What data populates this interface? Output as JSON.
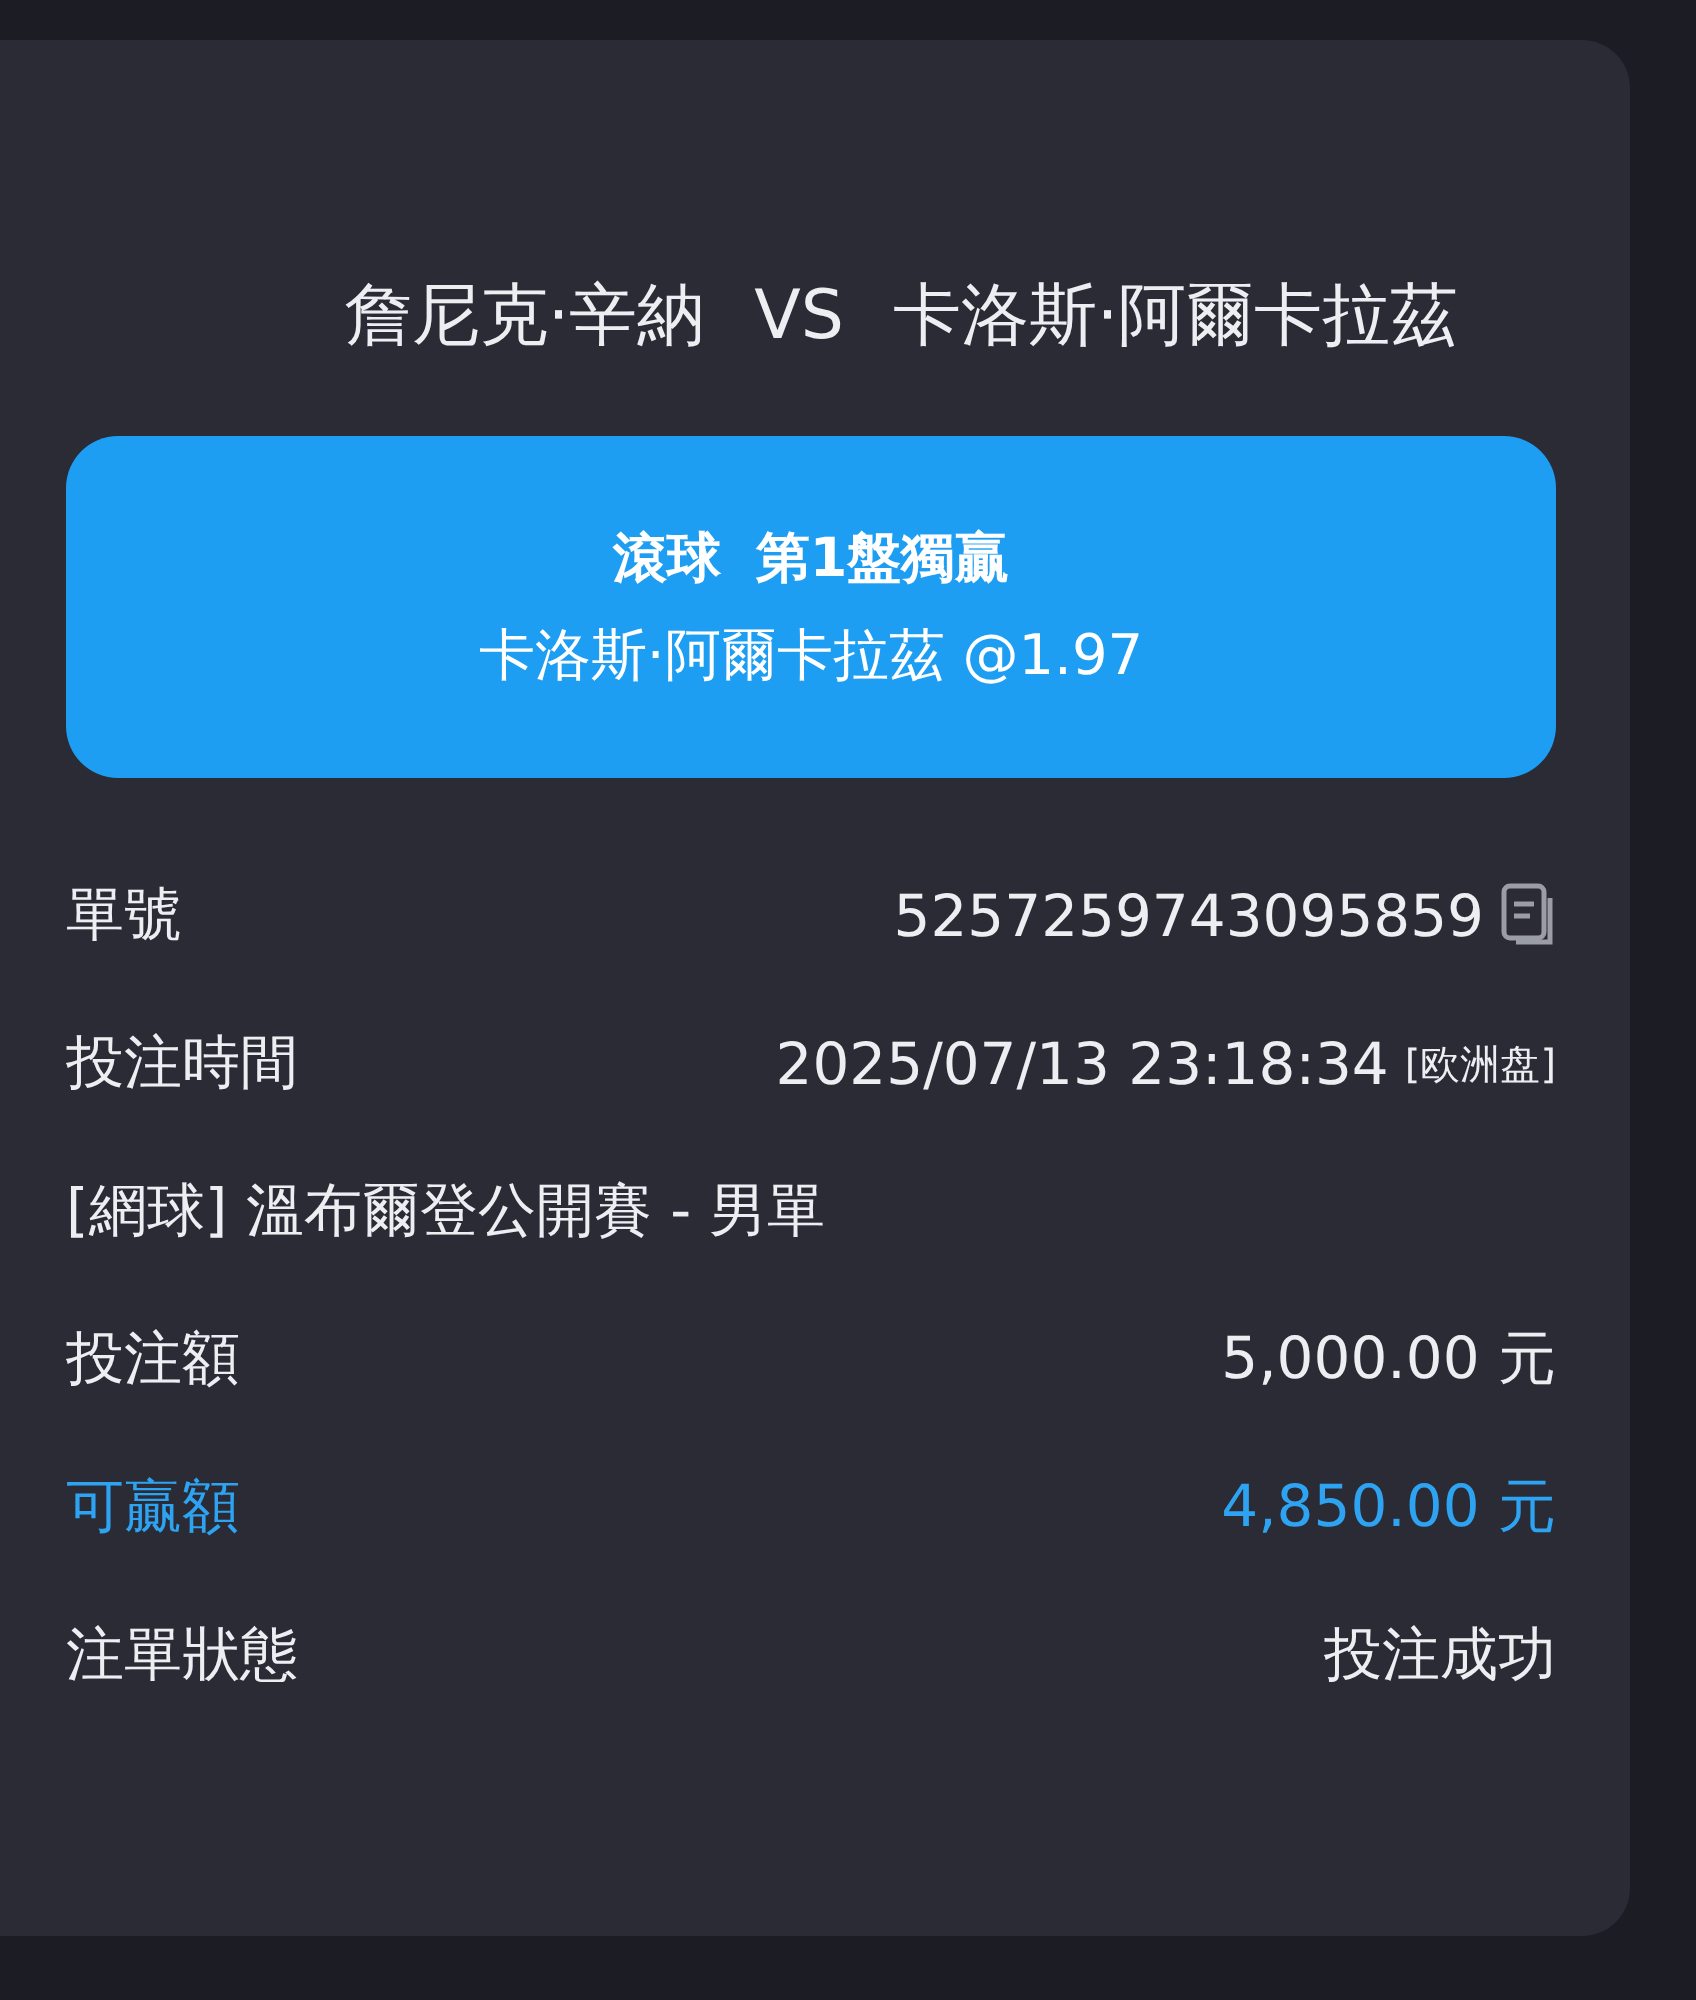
{
  "match": {
    "title": "詹尼克·辛納 VS 卡洛斯·阿爾卡拉茲"
  },
  "bet_banner": {
    "market": "滾球 第1盤獨贏",
    "selection": "卡洛斯·阿爾卡拉茲 @1.97"
  },
  "details": [
    {
      "kind": "pair",
      "label": "單號",
      "value": "5257259743095859",
      "copyable": true,
      "highlight": false
    },
    {
      "kind": "pair",
      "label": "投注時間",
      "value": "2025/07/13 23:18:34",
      "tag": "[欧洲盘]",
      "copyable": false,
      "highlight": false
    },
    {
      "kind": "full",
      "text": "[網球] 溫布爾登公開賽 - 男單"
    },
    {
      "kind": "pair",
      "label": "投注額",
      "value": "5,000.00 元",
      "copyable": false,
      "highlight": false
    },
    {
      "kind": "pair",
      "label": "可贏額",
      "value": "4,850.00 元",
      "copyable": false,
      "highlight": true
    },
    {
      "kind": "pair",
      "label": "注單狀態",
      "value": "投注成功",
      "copyable": false,
      "highlight": false
    }
  ]
}
